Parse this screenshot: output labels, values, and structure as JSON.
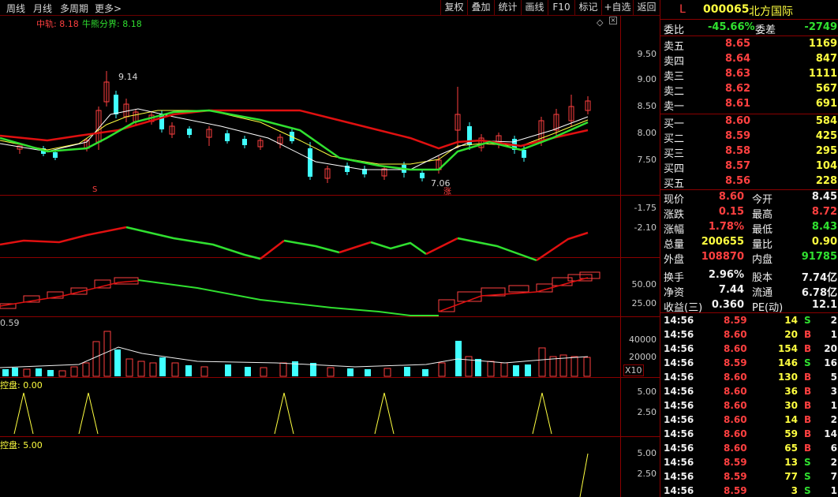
{
  "toolbar": {
    "period_items": [
      "周线",
      "月线",
      "多周期",
      "更多>"
    ],
    "tools": [
      "复权",
      "叠加",
      "统计",
      "画线",
      "F10",
      "标记",
      "+自选",
      "返回"
    ]
  },
  "main_chart": {
    "indicator_label_1": "中轨: 8.18",
    "indicator_label_2": "牛熊分界: 8.18",
    "y_ticks": [
      "9.50",
      "9.00",
      "8.50",
      "8.00",
      "7.50"
    ],
    "high_marker": "9.14",
    "low_marker": "7.06",
    "marker_up": "涨",
    "marker_s": "S"
  },
  "panel2": {
    "y_ticks": [
      "-1.75",
      "-2.10"
    ]
  },
  "panel3": {
    "y_ticks": [
      "50.00",
      "25.00"
    ]
  },
  "volume": {
    "label": "0.59",
    "y_ticks": [
      "40000",
      "20000"
    ],
    "unit": "X10"
  },
  "panel5": {
    "label": "控盘: 0.00",
    "y_ticks": [
      "5.00",
      "2.50"
    ]
  },
  "panel6": {
    "label": "控盘: 5.00",
    "y_ticks": [
      "5.00",
      "2.50"
    ]
  },
  "quote": {
    "code": "000065",
    "name": "北方国际",
    "flag": "L",
    "weibi_label": "委比",
    "weibi": "-45.66%",
    "weicha_label": "委差",
    "weicha": "-2749",
    "asks": [
      {
        "label": "卖五",
        "price": "8.65",
        "vol": "1169"
      },
      {
        "label": "卖四",
        "price": "8.64",
        "vol": "847"
      },
      {
        "label": "卖三",
        "price": "8.63",
        "vol": "1111"
      },
      {
        "label": "卖二",
        "price": "8.62",
        "vol": "567"
      },
      {
        "label": "卖一",
        "price": "8.61",
        "vol": "691"
      }
    ],
    "bids": [
      {
        "label": "买一",
        "price": "8.60",
        "vol": "584"
      },
      {
        "label": "买二",
        "price": "8.59",
        "vol": "425"
      },
      {
        "label": "买三",
        "price": "8.58",
        "vol": "295"
      },
      {
        "label": "买四",
        "price": "8.57",
        "vol": "104"
      },
      {
        "label": "买五",
        "price": "8.56",
        "vol": "228"
      }
    ],
    "stats": [
      {
        "l1": "现价",
        "v1": "8.60",
        "l2": "今开",
        "v2": "8.45"
      },
      {
        "l1": "涨跌",
        "v1": "0.15",
        "l2": "最高",
        "v2": "8.72"
      },
      {
        "l1": "涨幅",
        "v1": "1.78%",
        "l2": "最低",
        "v2": "8.43"
      },
      {
        "l1": "总量",
        "v1": "200655",
        "l2": "量比",
        "v2": "0.90"
      },
      {
        "l1": "外盘",
        "v1": "108870",
        "l2": "内盘",
        "v2": "91785"
      },
      {
        "l1": "换手",
        "v1": "2.96%",
        "l2": "股本",
        "v2": "7.74亿"
      },
      {
        "l1": "净资",
        "v1": "7.44",
        "l2": "流通",
        "v2": "6.78亿"
      },
      {
        "l1": "收益(三)",
        "v1": "0.360",
        "l2": "PE(动)",
        "v2": "12.1"
      }
    ],
    "trades": [
      {
        "t": "14:56",
        "p": "8.59",
        "v": "14",
        "bs": "S",
        "n": "2"
      },
      {
        "t": "14:56",
        "p": "8.60",
        "v": "20",
        "bs": "B",
        "n": "1"
      },
      {
        "t": "14:56",
        "p": "8.60",
        "v": "154",
        "bs": "B",
        "n": "20"
      },
      {
        "t": "14:56",
        "p": "8.59",
        "v": "146",
        "bs": "S",
        "n": "16"
      },
      {
        "t": "14:56",
        "p": "8.60",
        "v": "130",
        "bs": "B",
        "n": "5"
      },
      {
        "t": "14:56",
        "p": "8.60",
        "v": "36",
        "bs": "B",
        "n": "3"
      },
      {
        "t": "14:56",
        "p": "8.60",
        "v": "30",
        "bs": "B",
        "n": "1"
      },
      {
        "t": "14:56",
        "p": "8.60",
        "v": "14",
        "bs": "B",
        "n": "2"
      },
      {
        "t": "14:56",
        "p": "8.60",
        "v": "59",
        "bs": "B",
        "n": "14"
      },
      {
        "t": "14:56",
        "p": "8.60",
        "v": "65",
        "bs": "B",
        "n": "6"
      },
      {
        "t": "14:56",
        "p": "8.59",
        "v": "13",
        "bs": "S",
        "n": "2"
      },
      {
        "t": "14:56",
        "p": "8.59",
        "v": "77",
        "bs": "S",
        "n": "7"
      },
      {
        "t": "14:56",
        "p": "8.59",
        "v": "3",
        "bs": "S",
        "n": "1"
      }
    ]
  },
  "colors": {
    "up": "#ff4040",
    "down": "#40ffff",
    "ma_green": "#30e030",
    "ma_red": "#e01010",
    "bg": "#000000",
    "border": "#8b0000"
  }
}
